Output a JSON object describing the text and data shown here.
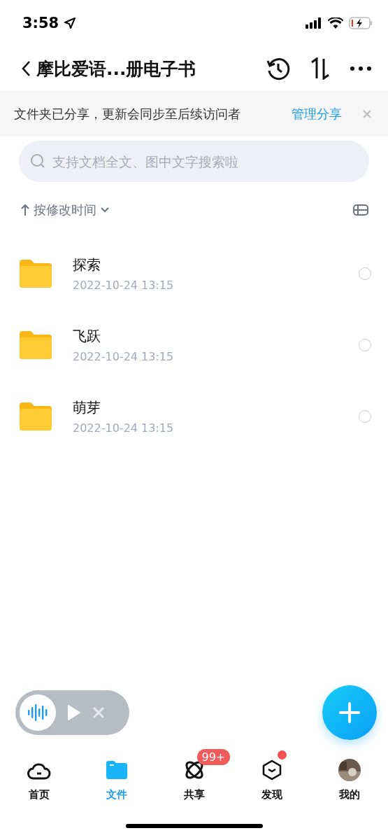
{
  "status_bar": {
    "time": "3:58"
  },
  "nav": {
    "title": "摩比爱语...册电子书"
  },
  "share_banner": {
    "text": "文件夹已分享，更新会同步至后续访问者",
    "link": "管理分享"
  },
  "search": {
    "placeholder": "支持文档全文、图中文字搜索啦"
  },
  "sort": {
    "label": "按修改时间"
  },
  "folders": [
    {
      "name": "探索",
      "date": "2022-10-24 13:15",
      "selected": false
    },
    {
      "name": "飞跃",
      "date": "2022-10-24 13:15",
      "selected": false
    },
    {
      "name": "萌芽",
      "date": "2022-10-24 13:15",
      "selected": false
    }
  ],
  "tab_bar": [
    {
      "kind": "home",
      "label": "首页",
      "selected": false
    },
    {
      "kind": "files",
      "label": "文件",
      "selected": true
    },
    {
      "kind": "share",
      "label": "共享",
      "selected": false,
      "badge": "99+"
    },
    {
      "kind": "discover",
      "label": "发现",
      "selected": false,
      "dot": true
    },
    {
      "kind": "profile",
      "label": "我的",
      "selected": false
    }
  ]
}
